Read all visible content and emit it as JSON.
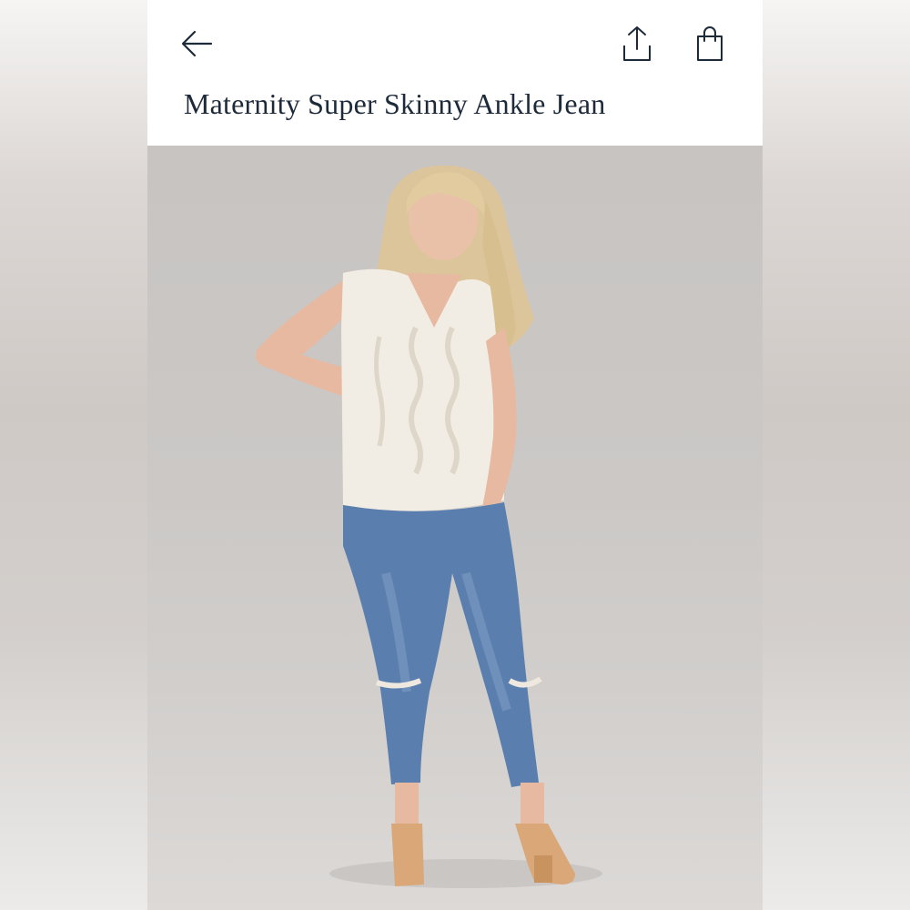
{
  "product": {
    "title": "Maternity Super Skinny Ankle Jean"
  },
  "icons": {
    "back": "arrow-left-icon",
    "share": "share-icon",
    "bag": "shopping-bag-icon"
  },
  "colors": {
    "title_text": "#1d2a3a",
    "photo_background": "#c9c6c4"
  }
}
